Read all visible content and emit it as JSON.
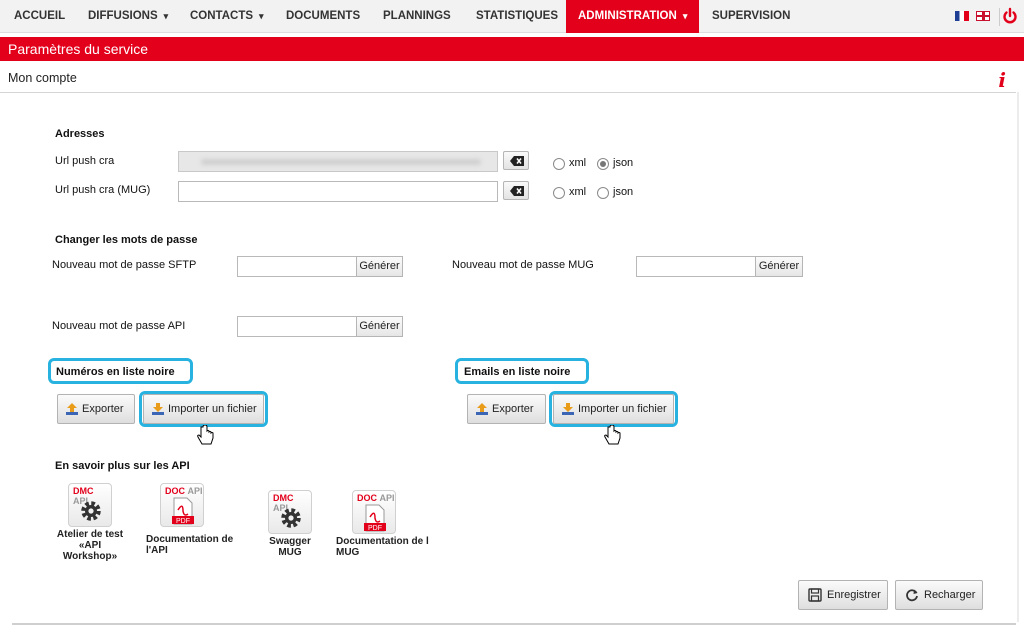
{
  "nav": {
    "items": [
      {
        "label": "ACCUEIL",
        "caret": ""
      },
      {
        "label": "DIFFUSIONS",
        "caret": "▾"
      },
      {
        "label": "CONTACTS",
        "caret": "▾"
      },
      {
        "label": "DOCUMENTS",
        "caret": ""
      },
      {
        "label": "PLANNINGS",
        "caret": ""
      },
      {
        "label": "STATISTIQUES",
        "caret": ""
      },
      {
        "label": "ADMINISTRATION",
        "caret": "▾"
      },
      {
        "label": "SUPERVISION",
        "caret": ""
      }
    ],
    "active_index": 6
  },
  "section": {
    "title": "Paramètres du service"
  },
  "subsection": {
    "title": "Mon compte",
    "info_glyph": "i"
  },
  "addresses": {
    "heading": "Adresses",
    "rows": [
      {
        "label": "Url push cra",
        "value": "",
        "format_xml": "xml",
        "format_json": "json",
        "selected": "json"
      },
      {
        "label": "Url push cra (MUG)",
        "value": "",
        "format_xml": "xml",
        "format_json": "json",
        "selected": ""
      }
    ]
  },
  "passwords": {
    "heading": "Changer les mots de passe",
    "sftp_label": "Nouveau mot de passe SFTP",
    "mug_label": "Nouveau mot de passe MUG",
    "api_label": "Nouveau mot de passe API",
    "generate_label": "Générer"
  },
  "blacklist": {
    "numbers_heading": "Numéros en liste noire",
    "emails_heading": "Emails en liste noire",
    "export_label": "Exporter",
    "import_label": "Importer un fichier"
  },
  "api": {
    "heading": "En savoir plus sur les API",
    "tiles": [
      {
        "tag_a": "DMC",
        "tag_b": "API",
        "caption_lines": [
          "Atelier de test",
          "«API",
          "Workshop»"
        ]
      },
      {
        "tag_a": "DOC",
        "tag_b": "API",
        "badge": "PDF",
        "caption_lines": [
          "Documentation de",
          "l'API"
        ]
      },
      {
        "tag_a": "DMC",
        "tag_b": "API",
        "caption_lines": [
          "Swagger",
          "MUG"
        ]
      },
      {
        "tag_a": "DOC",
        "tag_b": "API",
        "badge": "PDF",
        "caption_lines": [
          "Documentation de l",
          "MUG"
        ]
      }
    ]
  },
  "footer": {
    "save_label": "Enregistrer",
    "reload_label": "Recharger"
  },
  "colors": {
    "brand": "#e3001b",
    "highlight": "#28b2e0"
  }
}
